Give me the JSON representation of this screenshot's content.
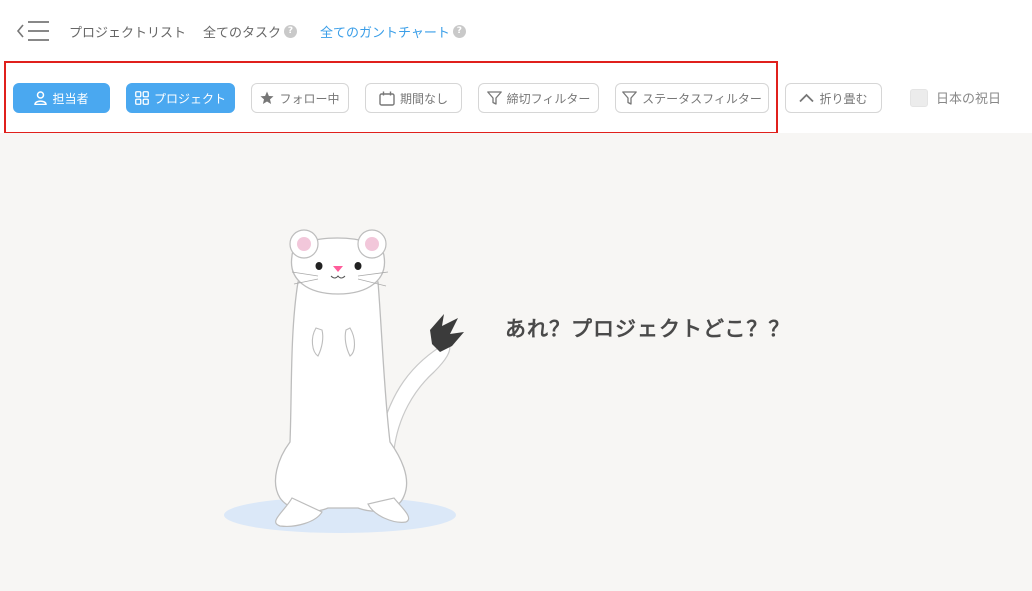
{
  "nav": {
    "tabs": [
      {
        "label": "プロジェクトリスト"
      },
      {
        "label": "全てのタスク"
      },
      {
        "label": "全てのガントチャート"
      }
    ],
    "help_glyph": "?"
  },
  "toolbar": {
    "assignee_label": "担当者",
    "project_label": "プロジェクト",
    "following_label": "フォロー中",
    "no_deadline_label": "期間なし",
    "deadline_filter_label": "締切フィルター",
    "status_filter_label": "ステータスフィルター",
    "collapse_label": "折り畳む",
    "holiday_label": "日本の祝日",
    "holiday_checked": false
  },
  "empty_state": {
    "message": "あれ？プロジェクトどこ？？"
  },
  "colors": {
    "accent": "#4aa8f0",
    "active_tab": "#3a9ee8",
    "highlight_border": "#e0201c",
    "canvas_bg": "#f7f6f4"
  }
}
